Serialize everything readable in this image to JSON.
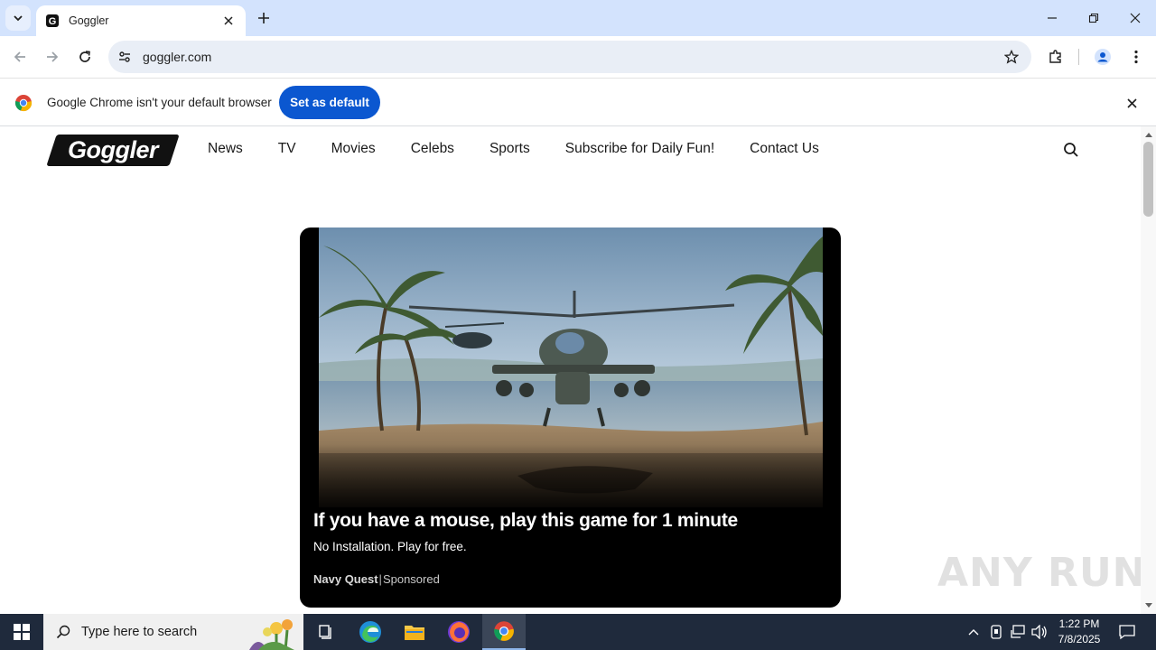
{
  "browser": {
    "tab_title": "Goggler",
    "url": "goggler.com"
  },
  "infobar": {
    "message": "Google Chrome isn't your default browser",
    "button": "Set as default"
  },
  "site": {
    "logo": "Goggler",
    "nav": [
      "News",
      "TV",
      "Movies",
      "Celebs",
      "Sports",
      "Subscribe for Daily Fun!",
      "Contact Us"
    ]
  },
  "ad": {
    "title": "If you have a mouse, play this game for 1 minute",
    "subtitle": "No Installation. Play for free.",
    "brand": "Navy Quest",
    "separator": "|",
    "label": "Sponsored"
  },
  "watermark": "ANY RUN",
  "taskbar": {
    "search_placeholder": "Type here to search",
    "time": "1:22 PM",
    "date": "7/8/2025"
  },
  "colors": {
    "tabstrip": "#d3e3fd",
    "accent_button": "#0b57d0",
    "taskbar": "#1f2a3c"
  }
}
